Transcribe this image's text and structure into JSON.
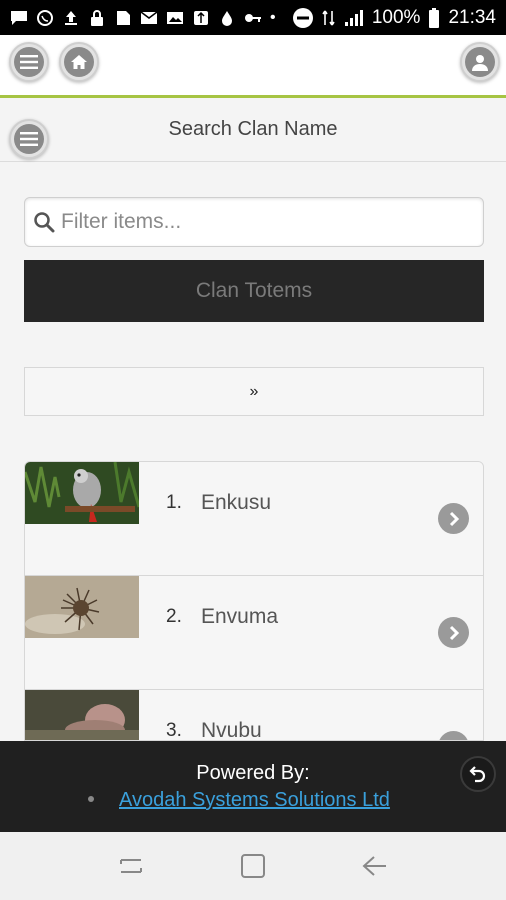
{
  "status_bar": {
    "battery": "100%",
    "time": "21:34",
    "icons": [
      "message-icon",
      "whatsapp-icon",
      "upload-icon",
      "lock-icon",
      "sim-icon",
      "mail-icon",
      "image-icon",
      "usb-icon",
      "water-drop-icon",
      "key-icon",
      "dnd-icon",
      "lte-icon",
      "signal-icon",
      "battery-icon"
    ]
  },
  "toolbar": {
    "menu_icon": "menu-icon",
    "home_icon": "home-icon",
    "user_icon": "user-icon"
  },
  "subheader": {
    "title": "Search Clan Name",
    "menu_icon": "menu-icon"
  },
  "search": {
    "placeholder": "Filter items...",
    "value": ""
  },
  "header_bar": {
    "label": "Clan Totems"
  },
  "pager": {
    "label": "»"
  },
  "clans": [
    {
      "number": "1.",
      "name": "Enkusu"
    },
    {
      "number": "2.",
      "name": "Envuma"
    },
    {
      "number": "3.",
      "name": "Nvubu"
    }
  ],
  "footer": {
    "powered_by": "Powered By:",
    "company_link": "Avodah Systems Solutions Ltd"
  },
  "colors": {
    "accent": "#a6c443",
    "dark_bar": "#262626",
    "link": "#3aa0dc"
  }
}
